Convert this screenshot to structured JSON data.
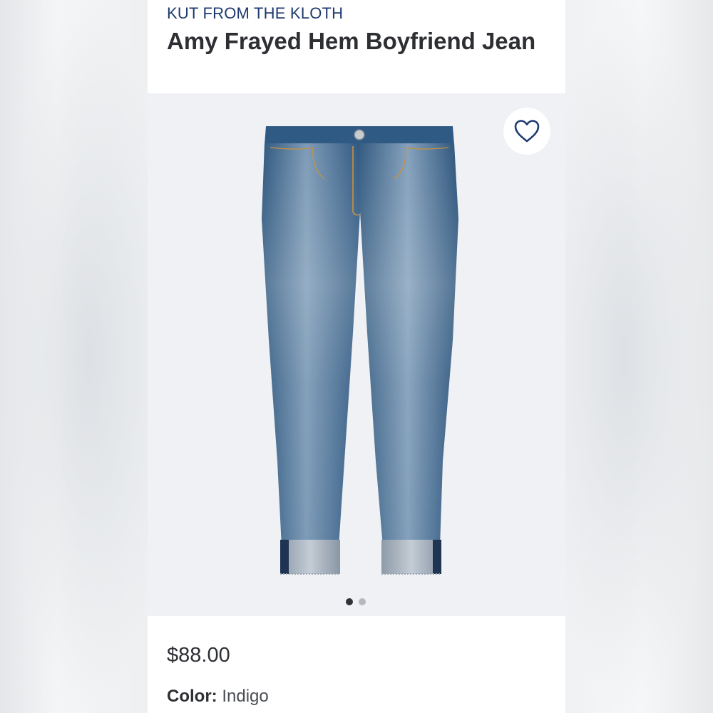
{
  "product": {
    "brand": "KUT FROM THE KLOTH",
    "title": "Amy Frayed Hem Boyfriend Jean",
    "price": "$88.00",
    "color_label": "Color:",
    "color_value": "Indigo"
  },
  "gallery": {
    "image_subject": "jeans-product-image",
    "dots": [
      {
        "active": true
      },
      {
        "active": false
      }
    ]
  },
  "icons": {
    "favorite": "heart-outline-icon"
  },
  "colors": {
    "brand_text": "#1e3a6e",
    "title_text": "#2d2f33",
    "image_bg": "#eff1f4",
    "denim": "#3f6a92"
  }
}
